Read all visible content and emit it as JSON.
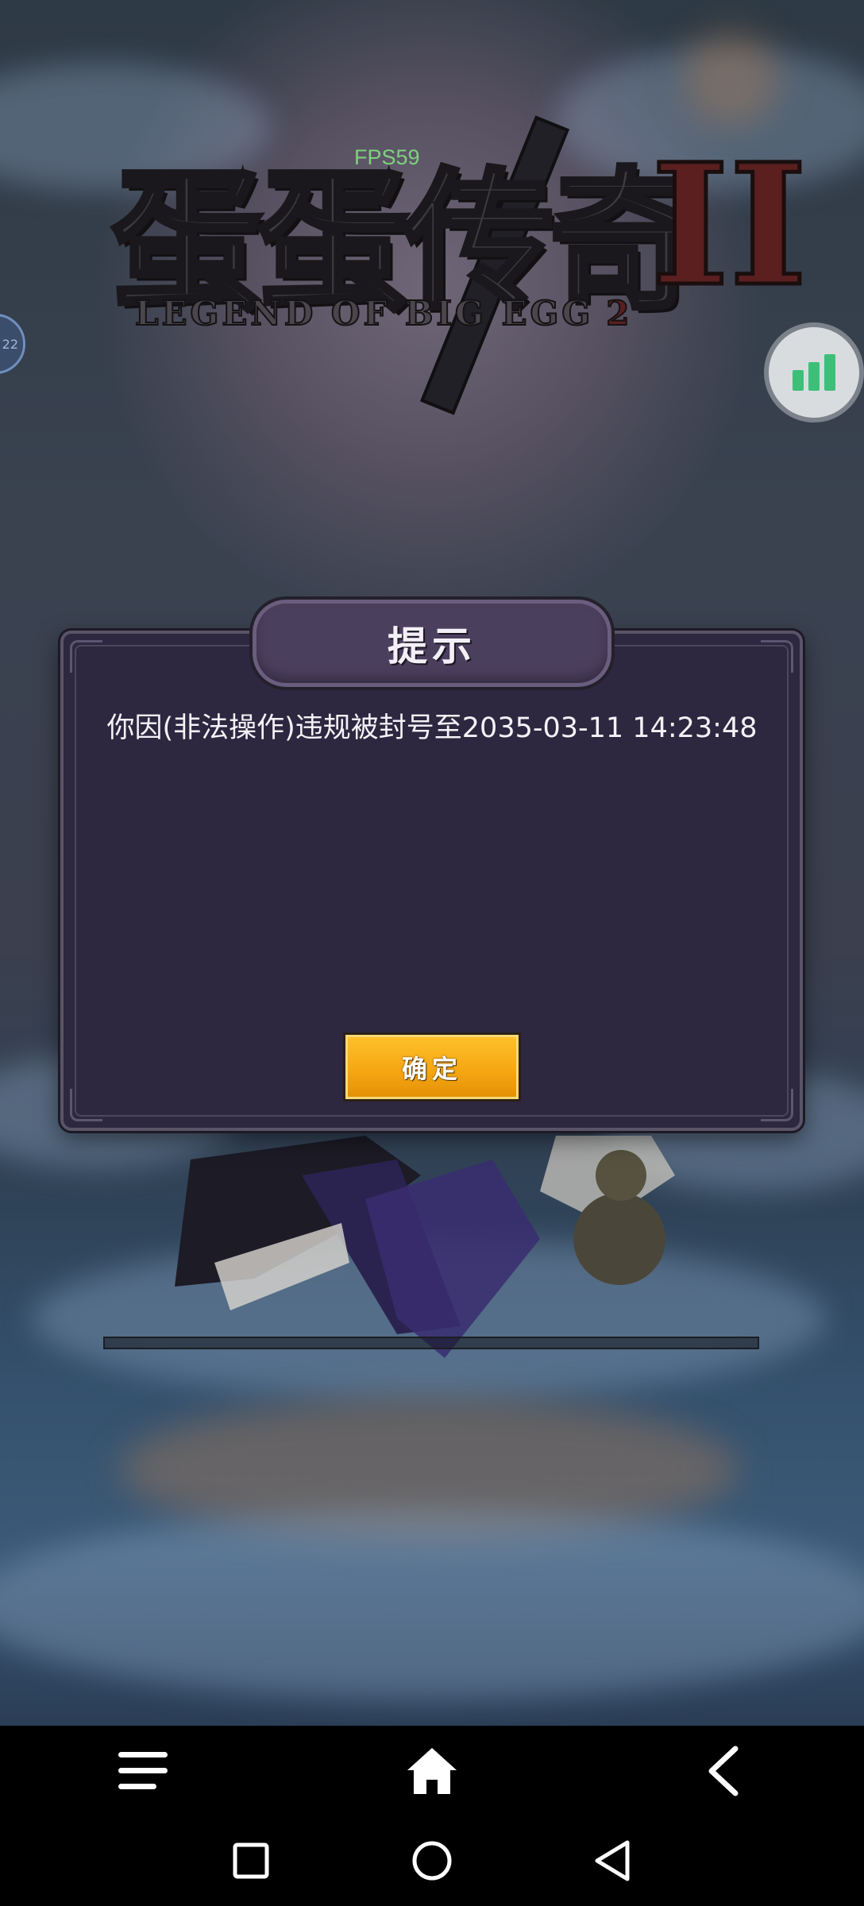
{
  "scene": {
    "fps_label": "FPS59",
    "left_bubble_text": "22",
    "logo": {
      "chinese_title": "蛋蛋传奇",
      "roman_numeral": "II",
      "english_subtitle_left": "LEGEND OF",
      "english_subtitle_right": "BIG EGG",
      "english_subtitle_number": "2"
    }
  },
  "dialog": {
    "title": "提示",
    "message": "你因(非法操作)违规被封号至2035-03-11 14:23:48",
    "confirm_label": "确定"
  },
  "game_nav": {
    "icons": [
      "menu-icon",
      "home-icon",
      "back-chevron-icon"
    ]
  },
  "system_nav": {
    "icons": [
      "recents-square-icon",
      "home-circle-icon",
      "back-triangle-icon"
    ]
  },
  "colors": {
    "dialog_bg": "#2e2740",
    "confirm_button": "#f4a510",
    "stats_icon": "#3dbf7a",
    "fps_text": "#7fd07f"
  }
}
